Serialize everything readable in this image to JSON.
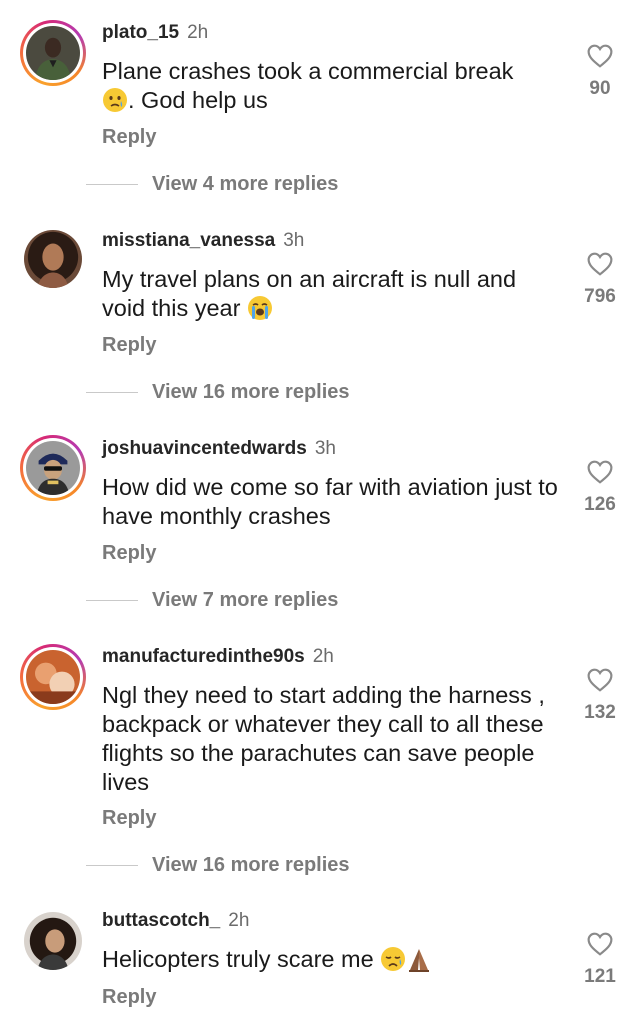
{
  "comments": [
    {
      "username": "plato_15",
      "time": "2h",
      "text": "Plane crashes took a commercial break",
      "text_after_emoji": ". God help us",
      "emoji": "crying-face",
      "reply_label": "Reply",
      "likes": "90",
      "view_more": "View 4 more replies",
      "avatar": "man-in-green-jacket",
      "story_ring": true
    },
    {
      "username": "misstiana_vanessa",
      "time": "3h",
      "text": "My travel plans on an aircraft is null and void this year",
      "emoji": "loudly-crying-face",
      "reply_label": "Reply",
      "likes": "796",
      "view_more": "View 16 more replies",
      "avatar": "woman-with-curly-hair",
      "story_ring": false
    },
    {
      "username": "joshuavincentedwards",
      "time": "3h",
      "text": "How did we come so far with aviation just to have monthly crashes",
      "reply_label": "Reply",
      "likes": "126",
      "view_more": "View 7 more replies",
      "avatar": "man-with-cap-and-sunglasses",
      "story_ring": true
    },
    {
      "username": "manufacturedinthe90s",
      "time": "2h",
      "text": "Ngl they need to start adding the harness , backpack or whatever they call to all these flights so the parachutes can save people lives",
      "reply_label": "Reply",
      "likes": "132",
      "view_more": "View 16 more replies",
      "avatar": "orange-toned-photo",
      "story_ring": true
    },
    {
      "username": "buttascotch_",
      "time": "2h",
      "text": "Helicopters truly scare me",
      "emoji": "sad-face-and-folded-hands",
      "reply_label": "Reply",
      "likes": "121",
      "avatar": "woman-with-dark-hair",
      "story_ring": false
    }
  ],
  "colors": {
    "username": "#262626",
    "secondary_text": "#7a7a7a",
    "body_text": "#1a1a1a",
    "story_ring": [
      "#f9a12c",
      "#d62976",
      "#b43bb2"
    ]
  },
  "icons": {
    "like": "heart-outline-icon"
  }
}
